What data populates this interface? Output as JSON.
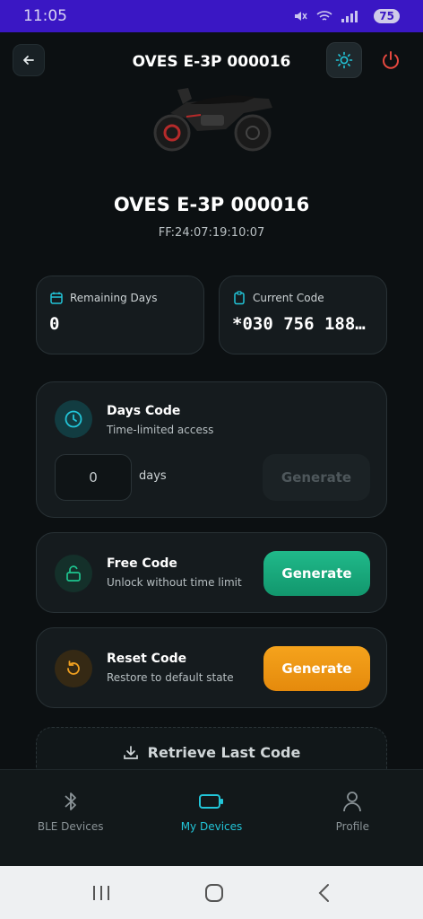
{
  "status_bar": {
    "time": "11:05",
    "battery": "75"
  },
  "header": {
    "title": "OVES E-3P 000016"
  },
  "device": {
    "name": "OVES E-3P 000016",
    "mac": "FF:24:07:19:10:07"
  },
  "stats": {
    "remaining_days": {
      "label": "Remaining Days",
      "value": "0"
    },
    "current_code": {
      "label": "Current Code",
      "value": "*030 756 188..."
    }
  },
  "days_code": {
    "title": "Days Code",
    "subtitle": "Time-limited access",
    "input_value": "0",
    "unit": "days",
    "button": "Generate"
  },
  "free_code": {
    "title": "Free Code",
    "subtitle": "Unlock without time limit",
    "button": "Generate"
  },
  "reset_code": {
    "title": "Reset Code",
    "subtitle": "Restore to default state",
    "button": "Generate"
  },
  "retrieve": {
    "label": "Retrieve Last Code"
  },
  "bottom_nav": [
    {
      "label": "BLE Devices"
    },
    {
      "label": "My Devices"
    },
    {
      "label": "Profile"
    }
  ],
  "colors": {
    "accent": "#22c5d8",
    "green": "#12976d",
    "orange": "#f5a31c",
    "status_bar": "#3a17c4"
  }
}
